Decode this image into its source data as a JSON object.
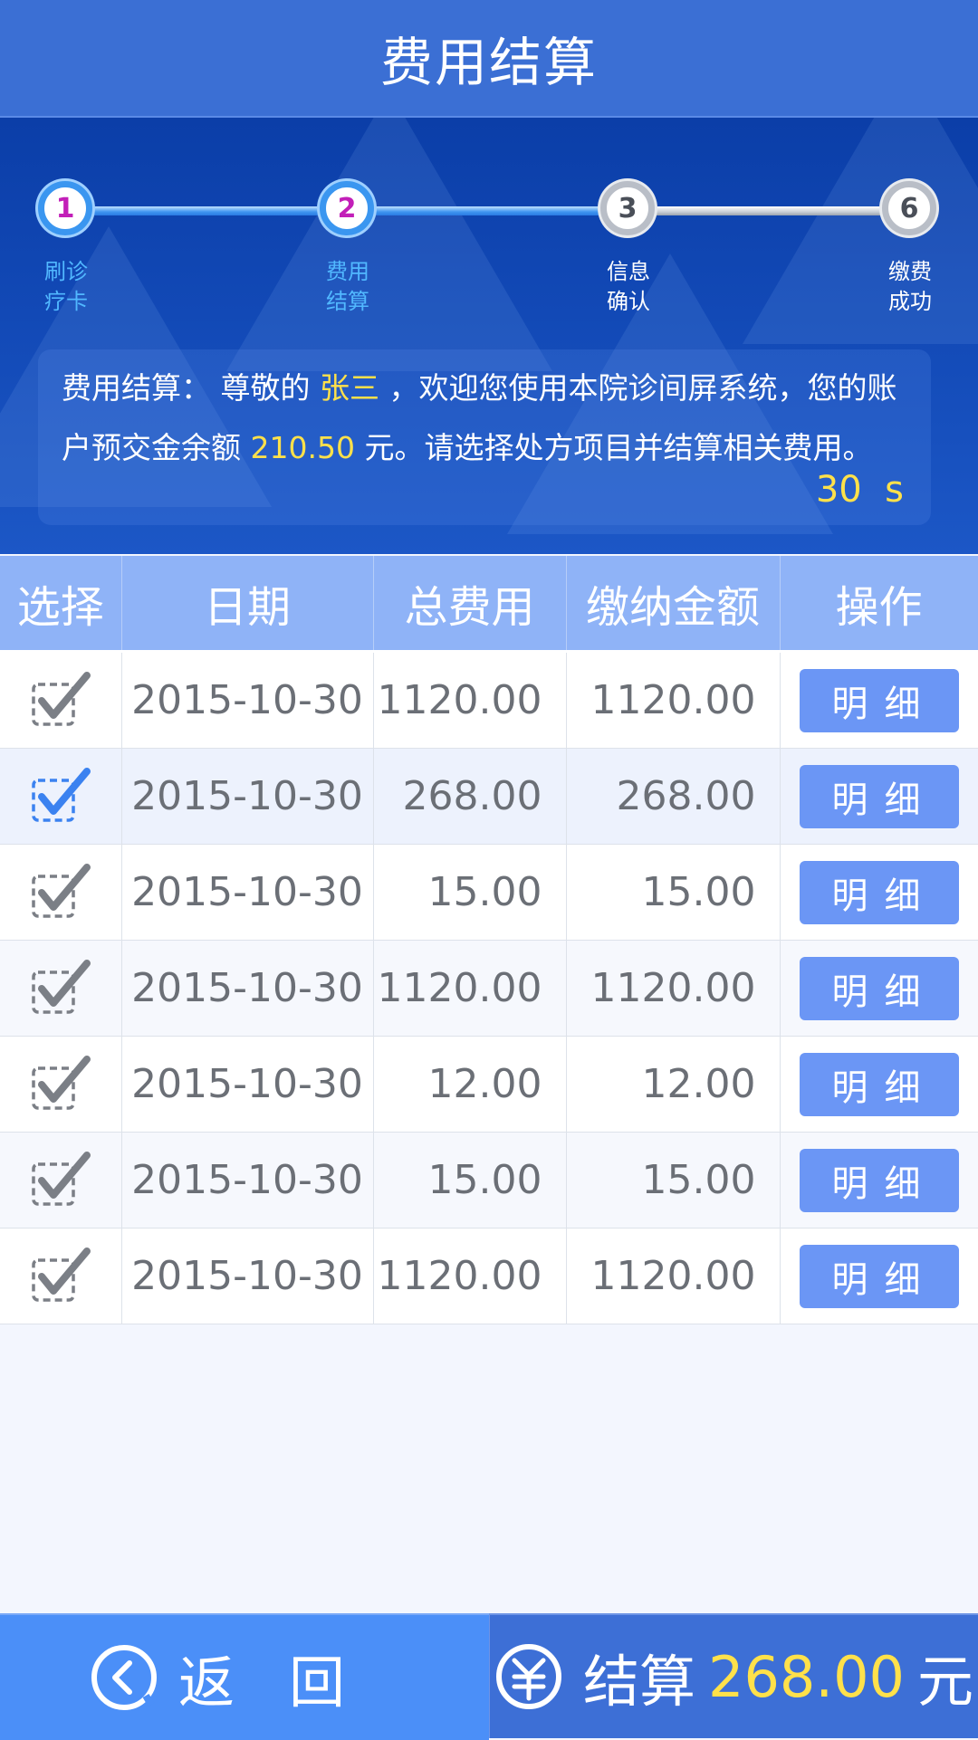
{
  "header": {
    "title": "费用结算"
  },
  "steps": [
    {
      "number": "1",
      "label_line1": "刷诊",
      "label_line2": "疗卡",
      "state": "done"
    },
    {
      "number": "2",
      "label_line1": "费用",
      "label_line2": "结算",
      "state": "done"
    },
    {
      "number": "3",
      "label_line1": "信息",
      "label_line2": "确认",
      "state": "todo"
    },
    {
      "number": "6",
      "label_line1": "缴费",
      "label_line2": "成功",
      "state": "todo"
    }
  ],
  "message": {
    "prefix": "费用结算： 尊敬的 ",
    "name": "张三",
    "middle": " ，欢迎您使用本院诊间屏系统，您的账户预交金余额 ",
    "balance": "210.50",
    "suffix": " 元。请选择处方项目并结算相关费用。",
    "countdown": "30  s"
  },
  "table": {
    "headers": [
      "选择",
      "日期",
      "总费用",
      "缴纳金额",
      "操作"
    ],
    "detail_label": "明细",
    "rows": [
      {
        "date": "2015-10-30",
        "total": "1120.00",
        "paid": "1120.00",
        "selected": false
      },
      {
        "date": "2015-10-30",
        "total": "268.00",
        "paid": "268.00",
        "selected": true
      },
      {
        "date": "2015-10-30",
        "total": "15.00",
        "paid": "15.00",
        "selected": false
      },
      {
        "date": "2015-10-30",
        "total": "1120.00",
        "paid": "1120.00",
        "selected": false
      },
      {
        "date": "2015-10-30",
        "total": "12.00",
        "paid": "12.00",
        "selected": false
      },
      {
        "date": "2015-10-30",
        "total": "15.00",
        "paid": "15.00",
        "selected": false
      },
      {
        "date": "2015-10-30",
        "total": "1120.00",
        "paid": "1120.00",
        "selected": false
      }
    ]
  },
  "footer": {
    "back_label": "返回",
    "pay_label": "结算",
    "pay_amount": "268.00",
    "pay_unit": "元"
  },
  "colors": {
    "header": "#3b6fd4",
    "accent_yellow": "#ffe14a",
    "step_done": "#3a96f0",
    "button_blue": "#6b96f5",
    "check_selected": "#3b82f0",
    "check_default": "#7b7f86"
  },
  "icons": {
    "back": "chevron-left-circle-icon",
    "pay": "yuan-circle-icon",
    "checkbox": "checkbox-check-icon"
  }
}
